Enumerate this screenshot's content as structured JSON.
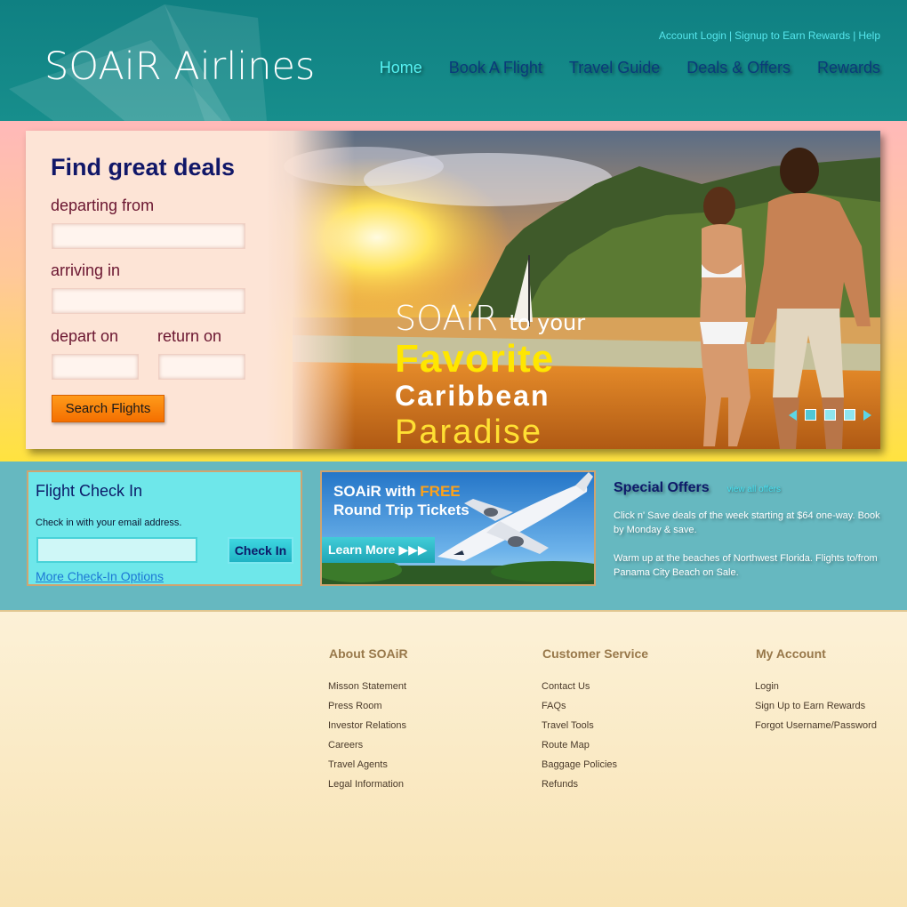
{
  "header": {
    "logo": "SOAiR Airlines",
    "top_links": [
      "Account Login",
      "Signup to Earn Rewards",
      "Help"
    ],
    "nav": [
      "Home",
      "Book A Flight",
      "Travel Guide",
      "Deals & Offers",
      "Rewards"
    ],
    "active_nav": "Home"
  },
  "search": {
    "title": "Find great deals",
    "departing_label": "departing from",
    "arriving_label": "arriving in",
    "depart_on_label": "depart on",
    "return_on_label": "return on",
    "departing_value": "",
    "arriving_value": "",
    "depart_value": "",
    "return_value": "",
    "button": "Search Flights"
  },
  "promo": {
    "brand": "SOAiR",
    "line1_rest": "to your",
    "line2": "Favorite",
    "line3": "Caribbean",
    "line4": "Paradise",
    "slides": 3,
    "active_slide": 1
  },
  "checkin": {
    "title": "Flight Check In",
    "description": "Check in with your email address.",
    "email_value": "",
    "button": "Check In",
    "more_link": "More Check-In Options"
  },
  "ad": {
    "line1_prefix": "SOAiR with",
    "line1_free": "FREE",
    "line2": "Round Trip Tickets",
    "button": "Learn More ▶▶▶"
  },
  "offers": {
    "title": "Special Offers",
    "view_all": "view all offers",
    "items": [
      "Click n' Save deals of the week starting at $64 one-way. Book by Monday & save.",
      "Warm up at the beaches of Northwest Florida. Flights to/from Panama City Beach on Sale."
    ]
  },
  "footer": {
    "columns": [
      {
        "title": "About SOAiR",
        "links": [
          "Misson Statement",
          "Press Room",
          "Investor Relations",
          "Careers",
          "Travel Agents",
          "Legal Information"
        ]
      },
      {
        "title": "Customer Service",
        "links": [
          "Contact Us",
          "FAQs",
          "Travel Tools",
          "Route Map",
          "Baggage Policies",
          "Refunds"
        ]
      },
      {
        "title": "My Account",
        "links": [
          "Login",
          "Sign Up to Earn Rewards",
          "Forgot Username/Password"
        ]
      }
    ]
  }
}
